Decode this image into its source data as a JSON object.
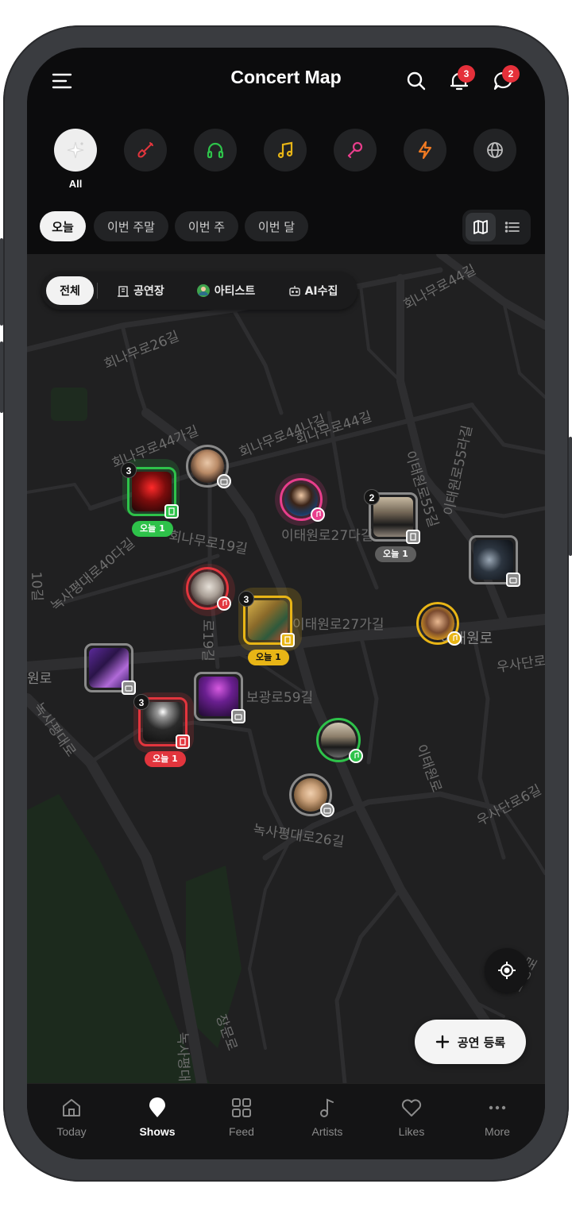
{
  "header": {
    "title": "Concert Map",
    "notifications_count": "3",
    "messages_count": "2"
  },
  "categories": {
    "all_label": "All",
    "items": [
      {
        "icon": "sparkle-icon",
        "color": "#cfcfcf"
      },
      {
        "icon": "guitar-icon",
        "color": "#e2353d"
      },
      {
        "icon": "headphones-icon",
        "color": "#2ec24a"
      },
      {
        "icon": "music-note-icon",
        "color": "#e8b516"
      },
      {
        "icon": "microphone-icon",
        "color": "#e83e8c"
      },
      {
        "icon": "lightning-icon",
        "color": "#f07a22"
      },
      {
        "icon": "globe-icon",
        "color": "#bdbdbd"
      }
    ]
  },
  "date_filters": {
    "today": "오늘",
    "this_weekend": "이번 주말",
    "this_week": "이번 주",
    "this_month": "이번 달"
  },
  "map": {
    "filter_all": "전체",
    "filter_venue": "공연장",
    "filter_artist": "아티스트",
    "filter_ai": "AI수집",
    "streets": [
      "회나무로44길",
      "회나무로26길",
      "회나무로44가길",
      "회나무로44나길",
      "회나무로44길",
      "이태원로55라길",
      "이태원로55길",
      "이태원로27다길",
      "이태원로27가길",
      "이태원로",
      "회나무로19길",
      "녹사평대로40다길",
      "보광로59길",
      "원로",
      "녹사평대로",
      "우사단로",
      "우사단로6길",
      "녹사평대로26길",
      "장문로",
      "녹사평대",
      "보광로",
      "10길",
      "이태원로"
    ],
    "markers": {
      "green_count": "3",
      "green_tag": "오늘 1",
      "gray_count": "2",
      "gray_tag": "오늘 1",
      "yellow_count": "3",
      "yellow_tag": "오늘 1",
      "red_count": "3",
      "red_tag": "오늘 1"
    },
    "add_button": "공연 등록"
  },
  "colors": {
    "green": "#2ec24a",
    "red": "#e2353d",
    "yellow": "#e8b516",
    "pink": "#e83e8c",
    "gray": "#8a8a8a"
  },
  "nav": {
    "today": "Today",
    "shows": "Shows",
    "feed": "Feed",
    "artists": "Artists",
    "likes": "Likes",
    "more": "More"
  }
}
